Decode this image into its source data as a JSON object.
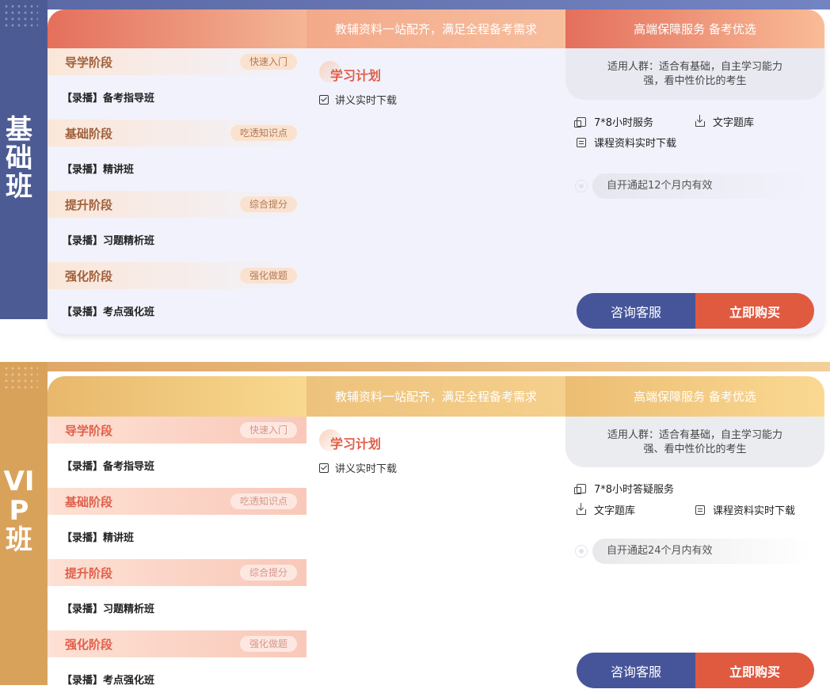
{
  "sections": {
    "basic": {
      "side_title": "基础班",
      "header_mid": "教辅资料一站配齐，满足全程备考需求",
      "header_right": "高端保障服务 备考优选",
      "stages": [
        {
          "name": "导学阶段",
          "tag": "快速入门",
          "course": "【录播】备考指导班"
        },
        {
          "name": "基础阶段",
          "tag": "吃透知识点",
          "course": "【录播】精讲班"
        },
        {
          "name": "提升阶段",
          "tag": "综合提分",
          "course": "【录播】习题精析班"
        },
        {
          "name": "强化阶段",
          "tag": "强化做题",
          "course": "【录播】考点强化班"
        }
      ],
      "plan_title": "学习计划",
      "plan_item": "讲义实时下载",
      "audience_line1": "适用人群：适合有基础，自主学习能力",
      "audience_line2": "强，看中性价比的考生",
      "features": [
        "7*8小时服务",
        "文字题库",
        "课程资料实时下载"
      ],
      "validity": "自开通起12个月内有效",
      "btn_consult": "咨询客服",
      "btn_buy": "立即购买"
    },
    "vip": {
      "side_title": "VIP班",
      "header_mid": "教辅资料一站配齐，满足全程备考需求",
      "header_right": "高端保障服务 备考优选",
      "stages": [
        {
          "name": "导学阶段",
          "tag": "快速入门",
          "course": "【录播】备考指导班"
        },
        {
          "name": "基础阶段",
          "tag": "吃透知识点",
          "course": "【录播】精讲班"
        },
        {
          "name": "提升阶段",
          "tag": "综合提分",
          "course": "【录播】习题精析班"
        },
        {
          "name": "强化阶段",
          "tag": "强化做题",
          "course": "【录播】考点强化班"
        }
      ],
      "plan_title": "学习计划",
      "plan_item": "讲义实时下载",
      "audience_line1": "适用人群：适合有基础，自主学习能力",
      "audience_line2": "强、看中性价比的考生",
      "features": [
        "7*8小时答疑服务",
        "文字题库",
        "课程资料实时下载"
      ],
      "validity": "自开通起24个月内有效",
      "btn_consult": "咨询客服",
      "btn_buy": "立即购买"
    }
  },
  "icons": {
    "service": "copy-icon",
    "question_bank": "download-icon",
    "materials": "document-icon",
    "validity": "radio-dot-icon",
    "plan_item": "checkbox-icon"
  },
  "colors": {
    "basic_side": "#4c5b94",
    "vip_side": "#d9a25b",
    "consult_button": "#46559a",
    "buy_button": "#e05a40",
    "stage_accent": "#e0604c"
  }
}
